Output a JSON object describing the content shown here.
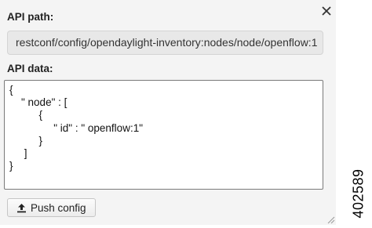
{
  "dialog": {
    "api_path_label": "API path:",
    "api_path_value": "restconf/config/opendaylight-inventory:nodes/node/openflow:1",
    "api_data_label": "API data:",
    "api_data_value": "{\n    \" node\" : [\n          {\n               \" id\" : \" openflow:1\"\n          }\n     ]\n}",
    "push_button_label": "Push config",
    "close_icon": "close-icon",
    "upload_icon": "upload-icon",
    "resize_icon": "resize-handle-icon"
  },
  "figure_id": "402589"
}
